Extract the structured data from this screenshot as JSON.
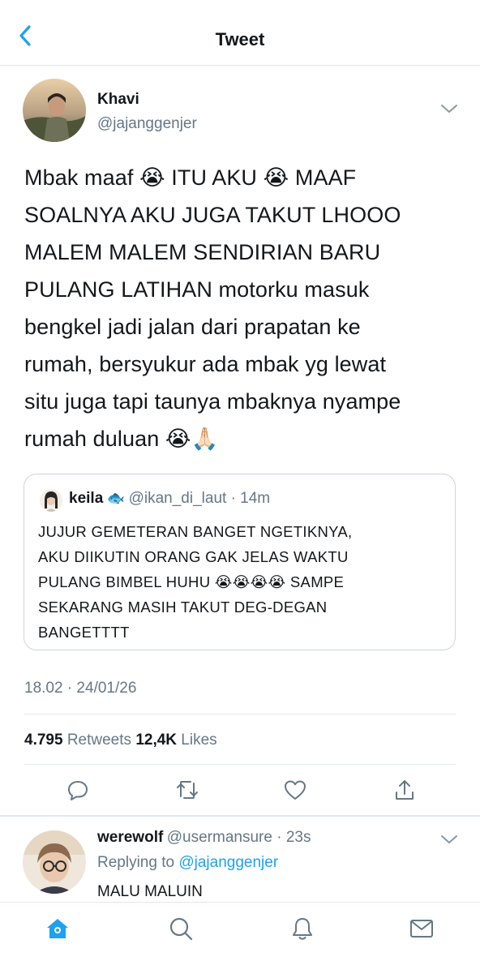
{
  "header": {
    "title": "Tweet"
  },
  "tweet": {
    "author_name": "Khavi",
    "author_handle": "@jajanggenjer",
    "lines": [
      "Mbak maaf 😭 ITU AKU 😭 MAAF",
      "SOALNYA AKU JUGA TAKUT LHOOO",
      "MALEM MALEM SENDIRIAN BARU",
      "PULANG LATIHAN motorku masuk",
      "bengkel jadi jalan dari prapatan ke",
      "rumah, bersyukur ada mbak yg lewat",
      "situ juga tapi taunya mbaknya nyampe",
      "rumah duluan 😭🙏🏻"
    ],
    "timestamp": "18.02 · 24/01/26",
    "retweets_count": "4.795",
    "retweets_label": "Retweets",
    "likes_count": "12,4K",
    "likes_label": "Likes"
  },
  "quoted": {
    "name": "keila",
    "name_emoji": "🐟",
    "handle_time": "@ikan_di_laut · 14m",
    "lines": [
      "JUJUR GEMETERAN BANGET NGETIKNYA,",
      "AKU DIIKUTIN ORANG GAK JELAS WAKTU",
      "PULANG BIMBEL HUHU 😭😭😭😭 SAMPE",
      "SEKARANG MASIH TAKUT DEG-DEGAN",
      "BANGETTTT"
    ]
  },
  "reply": {
    "name": "werewolf",
    "handle_time": "@usermansure · 23s",
    "replying_prefix": "Replying to",
    "replying_handle": "@jajanggenjer",
    "text": "MALU MALUIN"
  },
  "icons": {
    "back": "chevron-left-icon",
    "more": "chevron-down-icon",
    "reply": "reply-icon",
    "retweet": "retweet-icon",
    "like": "heart-icon",
    "share": "share-icon",
    "home": "home-icon",
    "search": "search-icon",
    "notifications": "bell-icon",
    "messages": "mail-icon"
  },
  "colors": {
    "accent": "#1da1f2",
    "secondary_text": "#657786",
    "divider": "#e1e8ed"
  }
}
